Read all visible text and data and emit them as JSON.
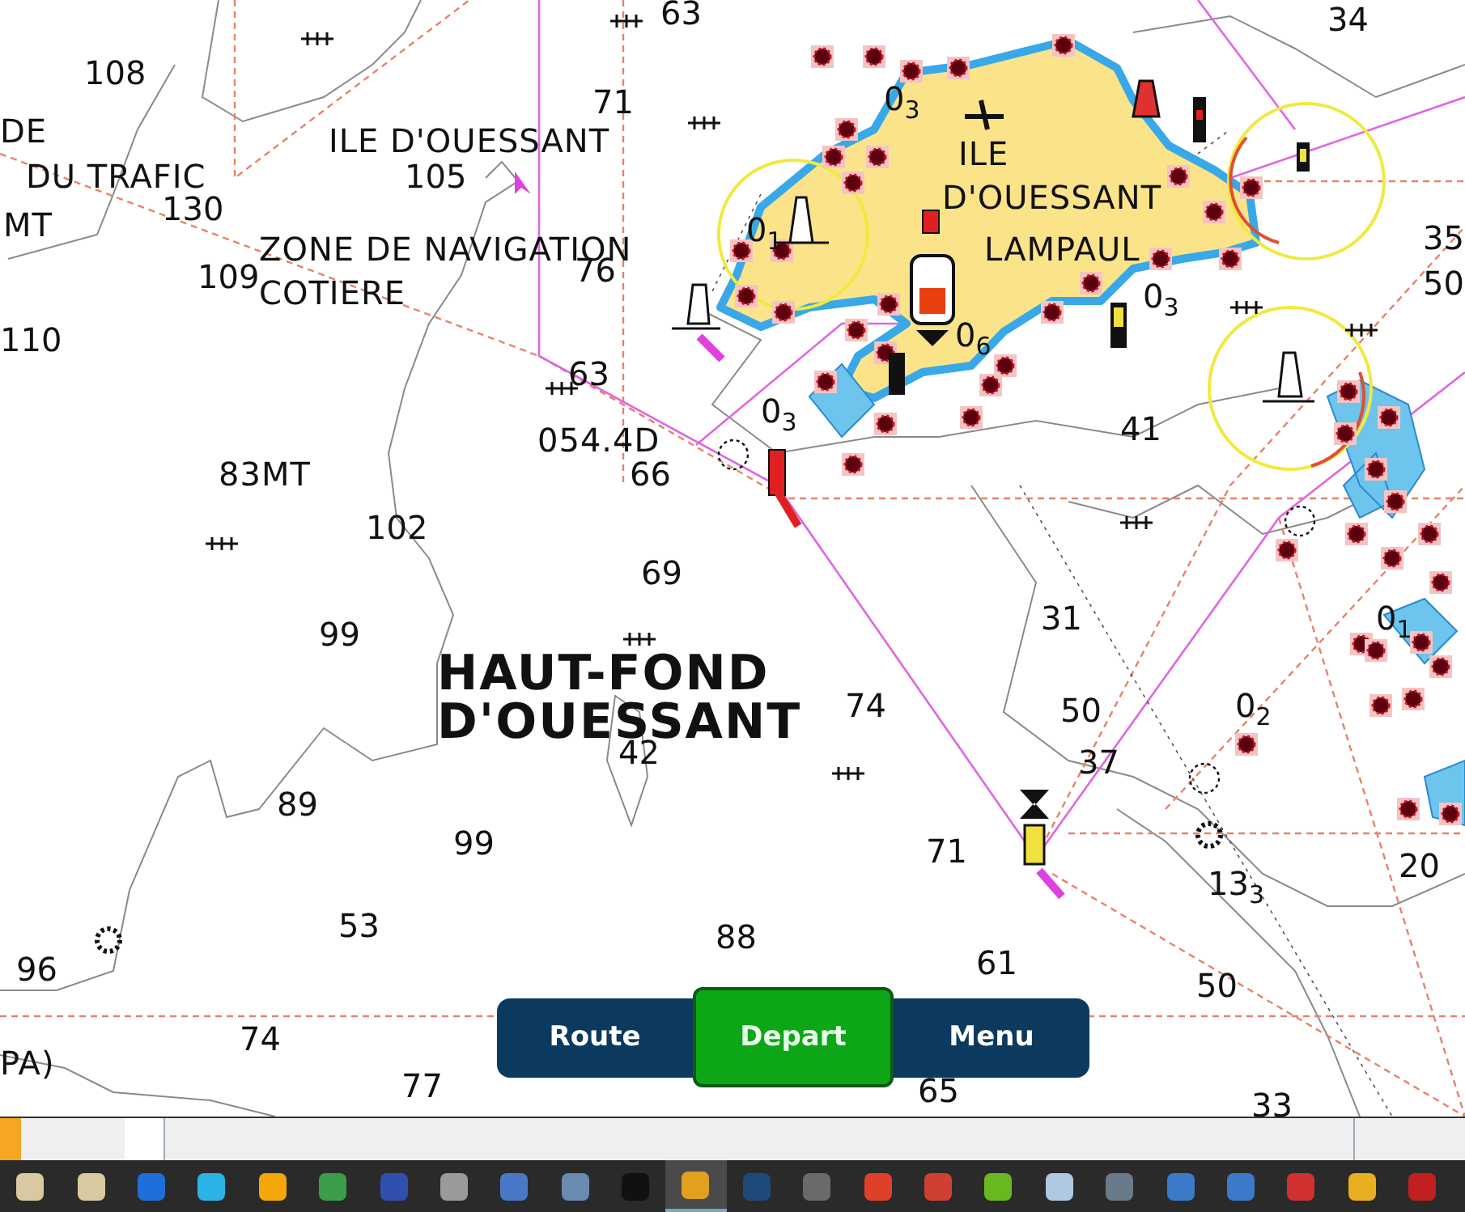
{
  "chart_labels": [
    {
      "kind": "place",
      "text": "DE"
    },
    {
      "kind": "place",
      "text": "DU TRAFIC"
    },
    {
      "kind": "place",
      "text": "MT"
    },
    {
      "kind": "place",
      "text": "ILE D'OUESSANT"
    },
    {
      "kind": "place",
      "text": "ZONE DE NAVIGATION"
    },
    {
      "kind": "place",
      "text": "COTIERE"
    },
    {
      "kind": "place",
      "text": "ILE"
    },
    {
      "kind": "place",
      "text": "D'OUESSANT"
    },
    {
      "kind": "place",
      "text": "LAMPAUL"
    },
    {
      "kind": "place",
      "text": "054.4D"
    },
    {
      "kind": "place",
      "text": "83MT"
    },
    {
      "kind": "place",
      "text": "PA)"
    },
    {
      "kind": "sounding",
      "text": "63"
    },
    {
      "kind": "sounding",
      "text": "34"
    },
    {
      "kind": "sounding",
      "text": "108"
    },
    {
      "kind": "sounding",
      "text": "71"
    },
    {
      "kind": "sounding",
      "text": "130"
    },
    {
      "kind": "sounding",
      "text": "105"
    },
    {
      "kind": "sounding",
      "text": "109"
    },
    {
      "kind": "sounding",
      "text": "110"
    },
    {
      "kind": "sounding",
      "text": "76"
    },
    {
      "kind": "sounding",
      "text": "63"
    },
    {
      "kind": "sounding",
      "text": "66"
    },
    {
      "kind": "sounding",
      "text": "0$_{3}$"
    },
    {
      "kind": "sounding",
      "text": "0$_{1}$"
    },
    {
      "kind": "sounding",
      "text": "0$_{3}$"
    },
    {
      "kind": "sounding",
      "text": "0$_{6}$"
    },
    {
      "kind": "sounding",
      "text": "0$_{3}$"
    },
    {
      "kind": "sounding",
      "text": "41"
    },
    {
      "kind": "sounding",
      "text": "35"
    },
    {
      "kind": "sounding",
      "text": "50"
    },
    {
      "kind": "sounding",
      "text": "102"
    },
    {
      "kind": "sounding",
      "text": "69"
    },
    {
      "kind": "sounding",
      "text": "99"
    },
    {
      "kind": "area",
      "text": "HAUT-FOND"
    },
    {
      "kind": "area",
      "text": "D'OUESSANT"
    },
    {
      "kind": "sounding",
      "text": "74"
    },
    {
      "kind": "sounding",
      "text": "42"
    },
    {
      "kind": "sounding",
      "text": "89"
    },
    {
      "kind": "sounding",
      "text": "99"
    },
    {
      "kind": "sounding",
      "text": "53"
    },
    {
      "kind": "sounding",
      "text": "96"
    },
    {
      "kind": "sounding",
      "text": "88"
    },
    {
      "kind": "sounding",
      "text": "71"
    },
    {
      "kind": "sounding",
      "text": "61"
    },
    {
      "kind": "sounding",
      "text": "31"
    },
    {
      "kind": "sounding",
      "text": "50"
    },
    {
      "kind": "sounding",
      "text": "37"
    },
    {
      "kind": "sounding",
      "text": "0$_{2}$"
    },
    {
      "kind": "sounding",
      "text": "0$_{1}$"
    },
    {
      "kind": "sounding",
      "text": "13$_{3}$"
    },
    {
      "kind": "sounding",
      "text": "20"
    },
    {
      "kind": "sounding",
      "text": "50"
    },
    {
      "kind": "sounding",
      "text": "74"
    },
    {
      "kind": "sounding",
      "text": "77"
    },
    {
      "kind": "sounding",
      "text": "65"
    },
    {
      "kind": "sounding",
      "text": "33"
    }
  ],
  "buttons": [
    {
      "label": "Route",
      "selected": false
    },
    {
      "label": "Depart",
      "selected": true
    },
    {
      "label": "Menu",
      "selected": false
    }
  ],
  "taskbar": [
    {
      "selected": false
    },
    {
      "selected": false
    },
    {
      "selected": false
    },
    {
      "selected": false
    },
    {
      "selected": false
    },
    {
      "selected": false
    },
    {
      "selected": false
    },
    {
      "selected": false
    },
    {
      "selected": false
    },
    {
      "selected": false
    },
    {
      "selected": false
    },
    {
      "selected": true
    },
    {
      "selected": false
    },
    {
      "selected": false
    },
    {
      "selected": false
    },
    {
      "selected": false
    },
    {
      "selected": false
    },
    {
      "selected": false
    },
    {
      "selected": false
    },
    {
      "selected": false
    },
    {
      "selected": false
    },
    {
      "selected": false
    },
    {
      "selected": false
    },
    {
      "selected": false
    }
  ]
}
